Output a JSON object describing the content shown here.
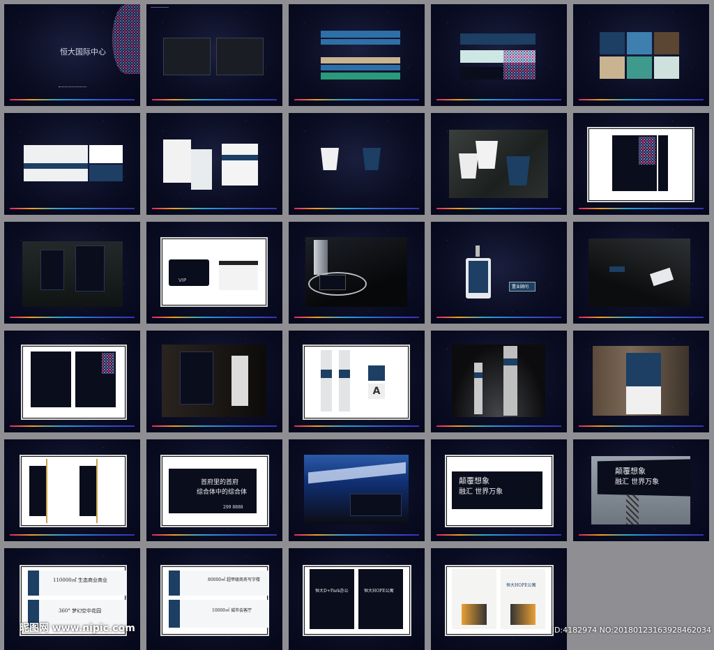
{
  "tiles": [
    {
      "id": "cover"
    },
    {
      "id": "grid-logos"
    },
    {
      "id": "color-bars"
    },
    {
      "id": "pattern-bars"
    },
    {
      "id": "color-swatches"
    },
    {
      "id": "business-card"
    },
    {
      "id": "envelope-stationery"
    },
    {
      "id": "paper-cups"
    },
    {
      "id": "cups-photo"
    },
    {
      "id": "poster-frame"
    },
    {
      "id": "shopping-bags"
    },
    {
      "id": "vip-card"
    },
    {
      "id": "vip-card-photo"
    },
    {
      "id": "badge"
    },
    {
      "id": "badge-photo"
    },
    {
      "id": "posters-pair"
    },
    {
      "id": "signage-photo"
    },
    {
      "id": "wayfinding"
    },
    {
      "id": "tower-signs"
    },
    {
      "id": "wall-sign"
    },
    {
      "id": "banners-pair"
    },
    {
      "id": "billboard-1"
    },
    {
      "id": "building-night"
    },
    {
      "id": "billboard-2"
    },
    {
      "id": "highway-billboard"
    },
    {
      "id": "print-ad-1"
    },
    {
      "id": "print-ad-2"
    },
    {
      "id": "print-ads-3"
    },
    {
      "id": "print-ads-4"
    }
  ],
  "texts": {
    "cover_logo": "恒大国际中心",
    "ad1_line1": "首府里的首府",
    "ad1_line2": "综合体中的综合体",
    "ad_phone": "299 8888",
    "ad2_line1": "颠覆想象",
    "ad2_line2": "融汇 世界万象",
    "pa_a1": "110000㎡ 生态商业商业",
    "pa_a2": "360° 梦幻空中花园",
    "pa_b1": "80000㎡ 超甲级商务写字楼",
    "pa_b2": "10000㎡ 城市会客厅",
    "pa_c1": "恒大D+Park办公",
    "pa_c2": "恒大HOPE公寓",
    "pa_d1": "恒大HOPE公寓",
    "vip": "VIP",
    "badge_name": "置业顾问",
    "sign_letter": "A",
    "wm_left": "昵图网 www.nipic.com",
    "wm_right": "ID:4182974 NO:20180123163928462034"
  },
  "colors": {
    "navy": "#1c3f63",
    "accent_blue": "#2f6fa8",
    "sand": "#c8b491",
    "teal": "#3f9a8e",
    "brown": "#5a4632"
  }
}
